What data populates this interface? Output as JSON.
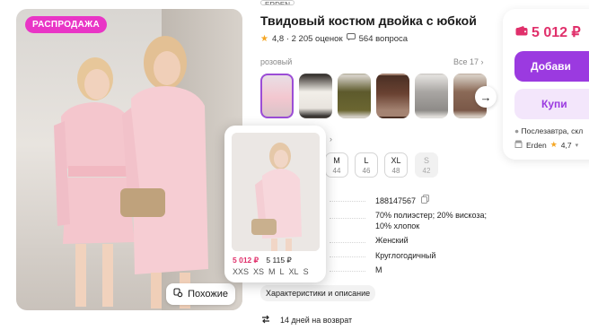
{
  "product": {
    "brand": "ERDEN",
    "title": "Твидовый костюм двойка с юбкой",
    "rating": "4,8 · 2 205 оценок",
    "questions": "564 вопроса"
  },
  "gallery": {
    "sale_badge": "РАСПРОДАЖА",
    "similar_button": "Похожие"
  },
  "colors": {
    "label": "розовый",
    "all_link": "Все 17 ›",
    "next_arrow": "→"
  },
  "sizes": [
    {
      "ru": "M",
      "eu": "44",
      "disabled": false
    },
    {
      "ru": "L",
      "eu": "46",
      "disabled": false
    },
    {
      "ru": "XL",
      "eu": "48",
      "disabled": false
    },
    {
      "ru": "S",
      "eu": "42",
      "disabled": true
    }
  ],
  "specs": {
    "article": "188147567",
    "composition": "70% полиэстер; 20% вискоза; 10% хлопок",
    "gender": "Женский",
    "season": "Круглогодичный",
    "size": "M"
  },
  "characteristics_button": "Характеристики и описание",
  "return_text": "14 дней на возврат",
  "buy": {
    "price": "5 012 ₽",
    "add_to_cart": "Добави",
    "buy_now": "Купи",
    "delivery": "Послезавтра, скл",
    "seller": "Erden",
    "seller_rating": "4,7"
  },
  "popup": {
    "price_new": "5 012 ₽",
    "price_old": "5 115 ₽",
    "sizes": [
      "XXS",
      "XS",
      "M",
      "L",
      "XL",
      "S"
    ]
  },
  "colors_theme": {
    "accent": "#9b3ae0",
    "price": "#e0306b",
    "sale": "#e935c6"
  }
}
